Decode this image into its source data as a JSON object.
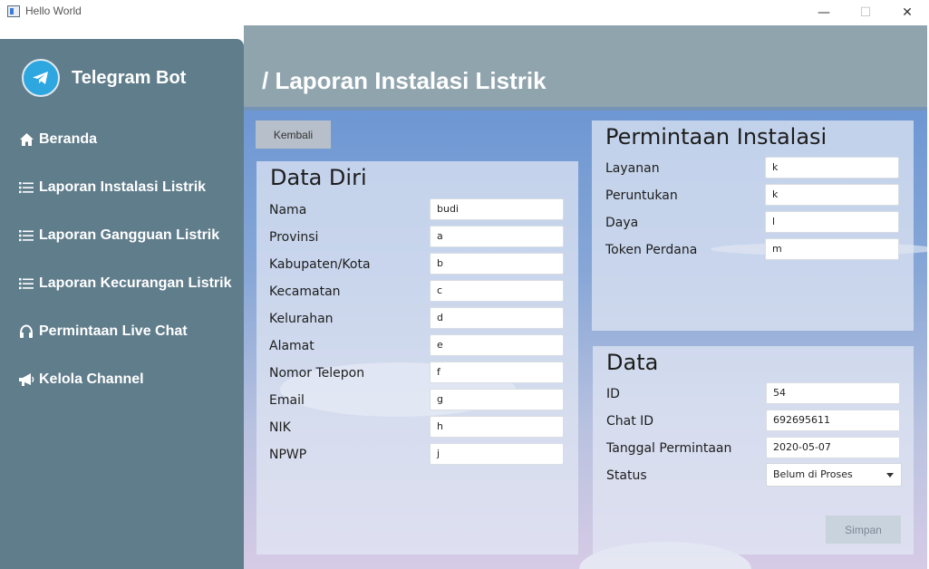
{
  "window": {
    "title": "Hello World",
    "minimize_glyph": "—",
    "maximize_glyph": "☐",
    "close_glyph": "✕"
  },
  "sidebar": {
    "brand": "Telegram Bot",
    "brand_icon": "telegram-logo",
    "items": [
      {
        "label": "Beranda",
        "icon": "home-icon"
      },
      {
        "label": "Laporan Instalasi Listrik",
        "icon": "list-icon"
      },
      {
        "label": "Laporan Gangguan Listrik",
        "icon": "list-icon"
      },
      {
        "label": "Laporan Kecurangan Listrik",
        "icon": "list-icon"
      },
      {
        "label": "Permintaan Live Chat",
        "icon": "headphones-icon"
      },
      {
        "label": "Kelola Channel",
        "icon": "bullhorn-icon"
      }
    ]
  },
  "header": {
    "title": "/ Laporan Instalasi Listrik"
  },
  "main": {
    "back_button": "Kembali",
    "data_diri": {
      "title": "Data Diri",
      "fields": [
        {
          "label": "Nama",
          "value": "budi"
        },
        {
          "label": "Provinsi",
          "value": "a"
        },
        {
          "label": "Kabupaten/Kota",
          "value": "b"
        },
        {
          "label": "Kecamatan",
          "value": "c"
        },
        {
          "label": "Kelurahan",
          "value": "d"
        },
        {
          "label": "Alamat",
          "value": "e"
        },
        {
          "label": "Nomor Telepon",
          "value": "f"
        },
        {
          "label": "Email",
          "value": "g"
        },
        {
          "label": "NIK",
          "value": "h"
        },
        {
          "label": "NPWP",
          "value": "j"
        }
      ]
    },
    "permintaan": {
      "title": "Permintaan Instalasi",
      "fields": [
        {
          "label": "Layanan",
          "value": "k"
        },
        {
          "label": "Peruntukan",
          "value": "k"
        },
        {
          "label": "Daya",
          "value": "l"
        },
        {
          "label": "Token Perdana",
          "value": "m"
        }
      ]
    },
    "data": {
      "title": "Data",
      "fields": [
        {
          "label": "ID",
          "value": "54"
        },
        {
          "label": "Chat ID",
          "value": "692695611"
        },
        {
          "label": "Tanggal Permintaan",
          "value": "2020-05-07"
        }
      ],
      "status_label": "Status",
      "status_value": "Belum di Proses",
      "save_button": "Simpan"
    }
  },
  "colors": {
    "sidebar": "#607d8b",
    "header": "#90a4ae",
    "accent": "#2ea6e0"
  }
}
